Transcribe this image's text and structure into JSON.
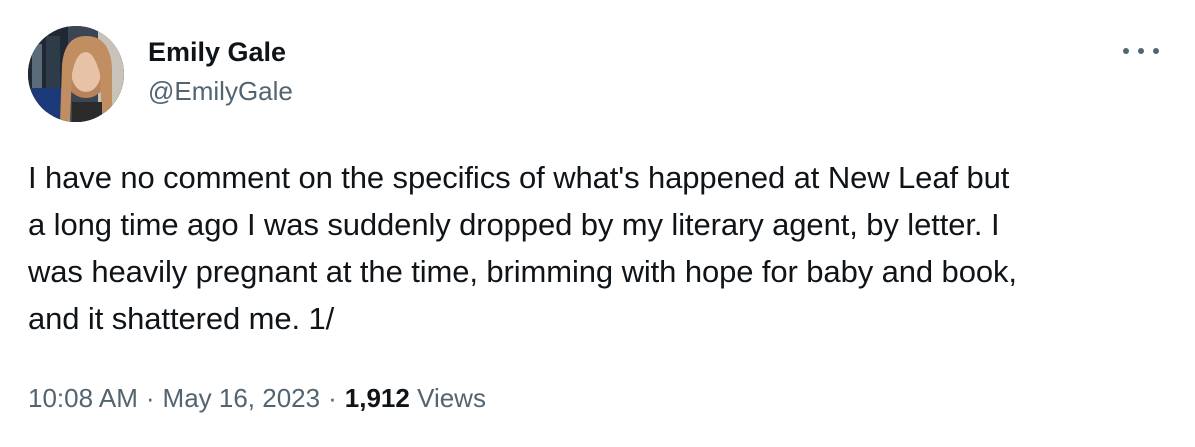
{
  "author": {
    "display_name": "Emily Gale",
    "handle": "@EmilyGale"
  },
  "tweet": {
    "text_lines": [
      "I have no comment on the specifics of what's happened at New Leaf but",
      "a long time ago I was suddenly dropped by my literary agent, by letter. I",
      "was heavily pregnant at the time, brimming with hope for baby and book,",
      "and it shattered me. 1/"
    ]
  },
  "meta": {
    "time": "10:08 AM",
    "separator": "·",
    "date": "May 16, 2023",
    "views_count": "1,912",
    "views_label": "Views"
  },
  "icons": {
    "more": "more-horizontal-icon"
  },
  "colors": {
    "text_primary": "#0f1419",
    "text_secondary": "#536471",
    "background": "#ffffff"
  }
}
